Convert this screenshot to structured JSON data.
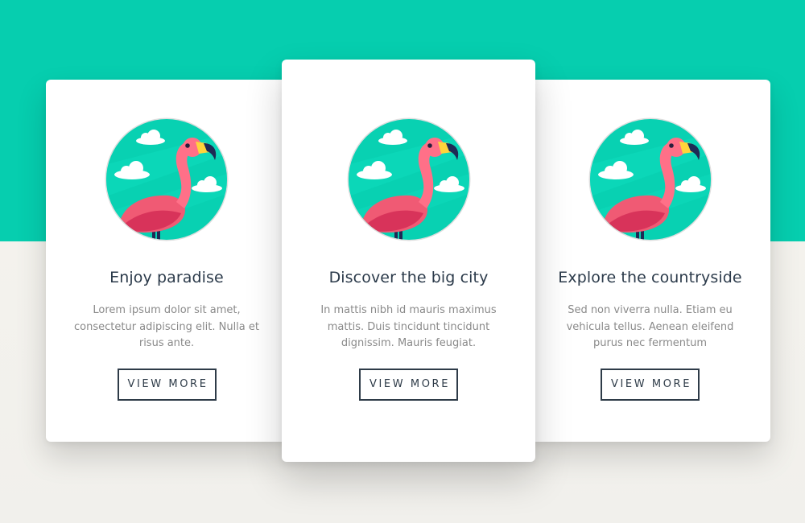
{
  "theme": {
    "band_color": "#06ceaf",
    "background_color": "#f6f4ee",
    "card_color": "#ffffff",
    "title_color": "#2b3a4a",
    "text_color": "#8a8a8a",
    "button_border_color": "#2e3b48"
  },
  "cards": [
    {
      "image_icon": "flamingo-icon",
      "title": "Enjoy paradise",
      "text": "Lorem ipsum dolor sit amet, consectetur adipiscing elit. Nulla et risus ante.",
      "button_label": "VIEW MORE"
    },
    {
      "image_icon": "flamingo-icon",
      "title": "Discover the big city",
      "text": "In mattis nibh id mauris maximus mattis. Duis tincidunt tincidunt dignissim. Mauris feugiat.",
      "button_label": "VIEW MORE"
    },
    {
      "image_icon": "flamingo-icon",
      "title": "Explore the countryside",
      "text": "Sed non viverra nulla. Etiam eu vehicula tellus. Aenean eleifend purus nec fermentum",
      "button_label": "VIEW MORE"
    }
  ]
}
